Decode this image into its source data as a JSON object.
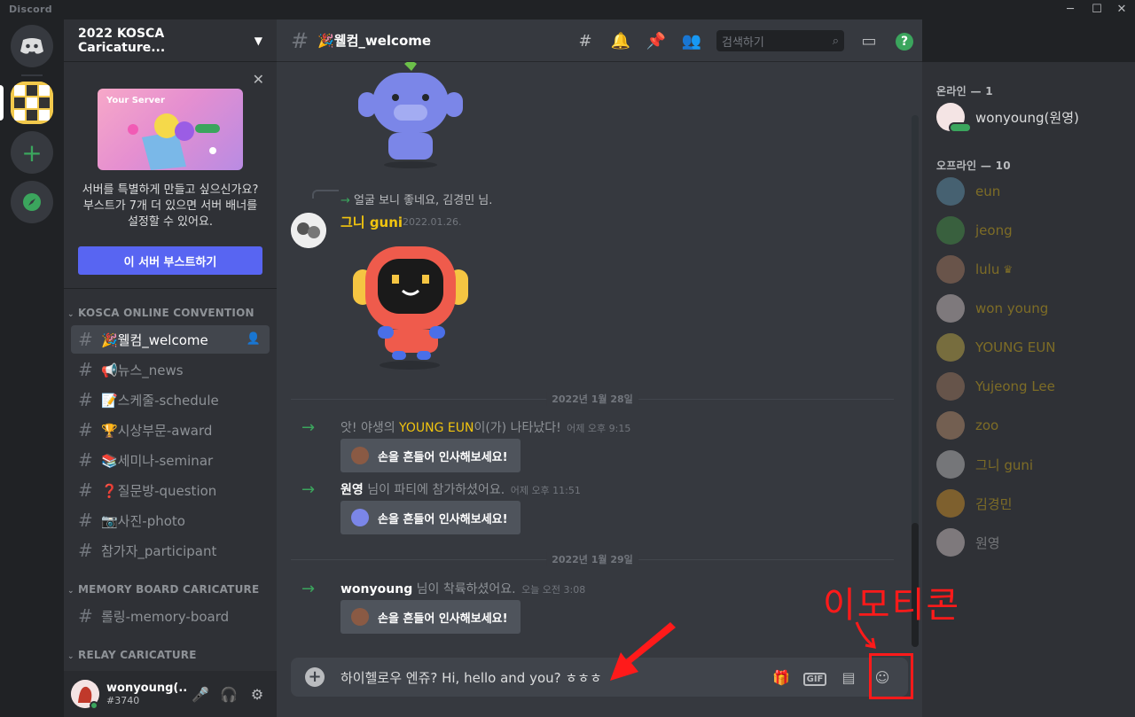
{
  "app": {
    "brand": "Discord"
  },
  "window_controls": {
    "minimize": "─",
    "maximize": "☐",
    "close": "✕"
  },
  "server": {
    "name": "2022 KOSCA Caricature..."
  },
  "boost": {
    "art_caption": "Your Server",
    "message_line1": "서버를 특별하게 만들고 싶으신가요?",
    "message_line2": "부스트가 7개 더 있으면 서버 배너를",
    "message_line3": "설정할 수 있어요.",
    "button": "이 서버 부스트하기"
  },
  "categories": [
    {
      "name": "KOSCA ONLINE CONVENTION"
    },
    {
      "name": "MEMORY BOARD CARICATURE"
    },
    {
      "name": "RELAY CARICATURE"
    }
  ],
  "channels": [
    {
      "name": "🎉웰컴_welcome",
      "active": true
    },
    {
      "name": "📢뉴스_news"
    },
    {
      "name": "📝스케줄-schedule"
    },
    {
      "name": "🏆시상부문-award"
    },
    {
      "name": "📚세미나-seminar"
    },
    {
      "name": "❓질문방-question"
    },
    {
      "name": "📷사진-photo"
    },
    {
      "name": "참가자_participant"
    },
    {
      "name": "롤링-memory-board"
    }
  ],
  "user": {
    "name": "wonyoung(...",
    "tag": "#3740"
  },
  "header": {
    "channel": "🎉웰컴_welcome",
    "search_placeholder": "검색하기"
  },
  "messages": {
    "reply_preview": "얼굴 보니 좋네요, 김경민 님.",
    "author": "그니 guni",
    "author_time": "2022.01.26.",
    "divider1": "2022년 1월 28일",
    "divider2": "2022년 1월 29일",
    "sys1_pre": "앗! 야생의 ",
    "sys1_name": "YOUNG EUN",
    "sys1_post": "이(가) 나타났다!",
    "sys1_time": "어제 오후 9:15",
    "sys2_name": "원영",
    "sys2_post": " 님이 파티에 참가하셨어요.",
    "sys2_time": "어제 오후 11:51",
    "sys3_name": "wonyoung",
    "sys3_post": " 님이 착륙하셨어요.",
    "sys3_time": "오늘 오전 3:08",
    "wave_label": "손을 흔들어 인사해보세요!"
  },
  "composer": {
    "text": "하이헬로우 엔쥬? Hi, hello and you? ㅎㅎㅎ",
    "gif": "GIF"
  },
  "members": {
    "online_header": "온라인 — 1",
    "offline_header": "오프라인 — 10",
    "online": [
      {
        "name": "wonyoung(원영)"
      }
    ],
    "offline": [
      {
        "name": "eun"
      },
      {
        "name": "jeong"
      },
      {
        "name": "lulu"
      },
      {
        "name": "won young"
      },
      {
        "name": "YOUNG EUN"
      },
      {
        "name": "Yujeong Lee"
      },
      {
        "name": "zoo"
      },
      {
        "name": "그니 guni"
      },
      {
        "name": "김경민"
      },
      {
        "name": "원영"
      }
    ]
  },
  "annotation": {
    "label": "이모티콘"
  },
  "colors": {
    "accent": "#5865f2",
    "online": "#3ba55d",
    "annot": "#ff1a1a"
  }
}
